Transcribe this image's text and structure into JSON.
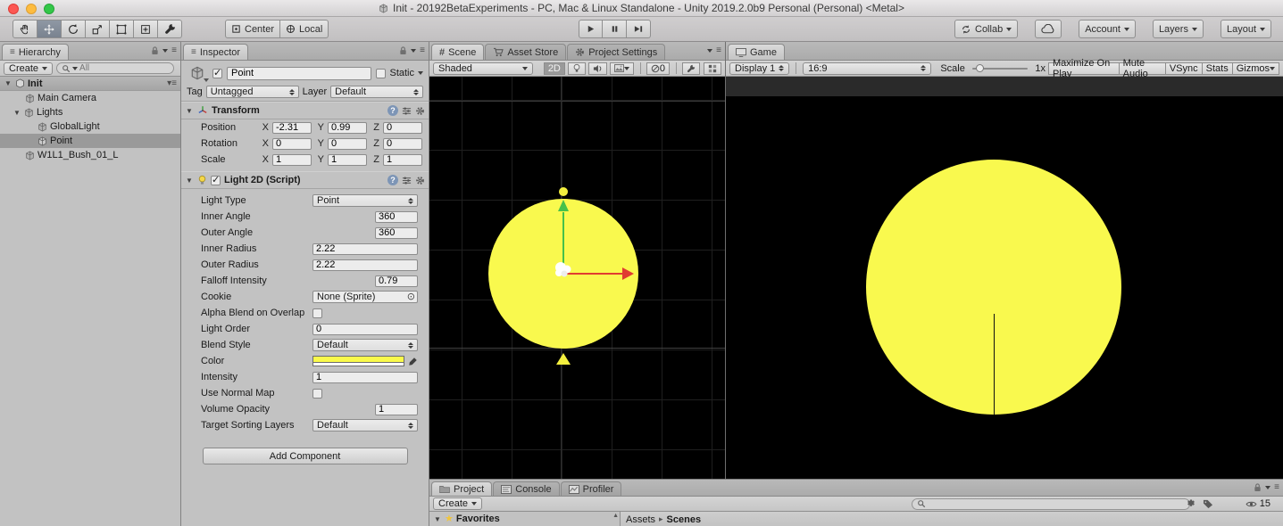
{
  "window": {
    "title": "Init - 20192BetaExperiments - PC, Mac & Linux Standalone - Unity 2019.2.0b9 Personal (Personal) <Metal>"
  },
  "toolbar": {
    "center": "Center",
    "local": "Local",
    "collab": "Collab",
    "account": "Account",
    "layers": "Layers",
    "layout": "Layout"
  },
  "hierarchy": {
    "tab": "Hierarchy",
    "create": "Create",
    "search_placeholder": "All",
    "scene_name": "Init",
    "items": [
      {
        "label": "Main Camera"
      },
      {
        "label": "Lights"
      },
      {
        "label": "GlobalLight"
      },
      {
        "label": "Point"
      },
      {
        "label": "W1L1_Bush_01_L"
      }
    ]
  },
  "inspector": {
    "tab": "Inspector",
    "name": "Point",
    "static": "Static",
    "tag_label": "Tag",
    "tag": "Untagged",
    "layer_label": "Layer",
    "layer": "Default",
    "transform": {
      "title": "Transform",
      "axis_x": "X",
      "axis_y": "Y",
      "axis_z": "Z",
      "position": {
        "label": "Position",
        "x": "-2.31",
        "y": "0.99",
        "z": "0"
      },
      "rotation": {
        "label": "Rotation",
        "x": "0",
        "y": "0",
        "z": "0"
      },
      "scale": {
        "label": "Scale",
        "x": "1",
        "y": "1",
        "z": "1"
      }
    },
    "light": {
      "title": "Light 2D (Script)",
      "light_type": {
        "label": "Light Type",
        "value": "Point"
      },
      "inner_angle": {
        "label": "Inner Angle",
        "value": "360"
      },
      "outer_angle": {
        "label": "Outer Angle",
        "value": "360"
      },
      "inner_radius": {
        "label": "Inner Radius",
        "value": "2.22"
      },
      "outer_radius": {
        "label": "Outer Radius",
        "value": "2.22"
      },
      "falloff_intensity": {
        "label": "Falloff Intensity",
        "value": "0.79"
      },
      "cookie": {
        "label": "Cookie",
        "value": "None (Sprite)"
      },
      "alpha_blend": {
        "label": "Alpha Blend on Overlap"
      },
      "light_order": {
        "label": "Light Order",
        "value": "0"
      },
      "blend_style": {
        "label": "Blend Style",
        "value": "Default"
      },
      "color": {
        "label": "Color",
        "value": "#f9f94a"
      },
      "intensity": {
        "label": "Intensity",
        "value": "1"
      },
      "use_normal_map": {
        "label": "Use Normal Map"
      },
      "volume_opacity": {
        "label": "Volume Opacity",
        "value": "1"
      },
      "target_sorting_layers": {
        "label": "Target Sorting Layers",
        "value": "Default"
      }
    },
    "add_component": "Add Component"
  },
  "scene": {
    "tabs": {
      "scene": "Scene",
      "asset_store": "Asset Store",
      "project_settings": "Project Settings"
    },
    "shading": "Shaded",
    "mode_2d": "2D",
    "gizmo_zero": "0"
  },
  "game": {
    "tab": "Game",
    "display": "Display 1",
    "aspect": "16:9",
    "scale_label": "Scale",
    "scale_value": "1x",
    "maximize": "Maximize On Play",
    "mute": "Mute Audio",
    "vsync": "VSync",
    "stats": "Stats",
    "gizmos": "Gizmos"
  },
  "project": {
    "tabs": {
      "project": "Project",
      "console": "Console",
      "profiler": "Profiler"
    },
    "create": "Create",
    "favorites": "Favorites",
    "breadcrumb": {
      "root": "Assets",
      "current": "Scenes"
    },
    "hidden_count": "15"
  },
  "colors": {
    "light_yellow": "#f9f94e",
    "gizmo_green": "#46c14a",
    "gizmo_red": "#e03c31",
    "selection_gray": "#9a9a9a"
  }
}
